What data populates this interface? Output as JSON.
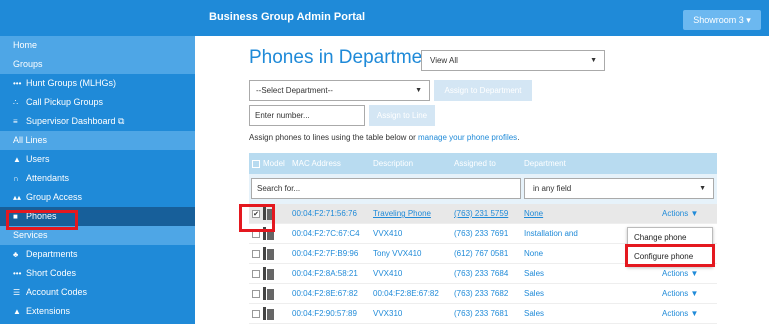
{
  "header": {
    "portal_title": "Business Group Admin Portal",
    "showroom": "Showroom 3 ▾"
  },
  "sidebar": {
    "items": [
      {
        "label": "Home",
        "section": true,
        "icon": ""
      },
      {
        "label": "Groups",
        "section": true,
        "icon": ""
      },
      {
        "label": "Hunt Groups (MLHGs)",
        "icon": "•••"
      },
      {
        "label": "Call Pickup Groups",
        "icon": "∴"
      },
      {
        "label": "Supervisor Dashboard ⧉",
        "icon": "≡"
      },
      {
        "label": "All Lines",
        "section": true,
        "icon": ""
      },
      {
        "label": "Users",
        "icon": "▲"
      },
      {
        "label": "Attendants",
        "icon": "∩"
      },
      {
        "label": "Group Access",
        "icon": "▴▴"
      },
      {
        "label": "Phones",
        "icon": "■",
        "active": true
      },
      {
        "label": "Services",
        "section": true,
        "icon": ""
      },
      {
        "label": "Departments",
        "icon": "♣"
      },
      {
        "label": "Short Codes",
        "icon": "•••"
      },
      {
        "label": "Account Codes",
        "icon": "☰"
      },
      {
        "label": "Extensions",
        "icon": "▲"
      }
    ]
  },
  "main": {
    "title": "Phones in Department:",
    "view_select": "View All",
    "dept_select": "--Select Department--",
    "assign_dept_btn": "Assign to Department",
    "number_placeholder": "Enter number...",
    "assign_line_btn": "Assign to Line",
    "help_prefix": "Assign phones to lines using the table below or ",
    "help_link": "manage your phone profiles",
    "help_suffix": "."
  },
  "table": {
    "headers": {
      "model": "Model",
      "mac": "MAC Address",
      "desc": "Description",
      "assigned": "Assigned to",
      "dept": "Department"
    },
    "search_placeholder": "Search for...",
    "field_select": "in any field",
    "rows": [
      {
        "mac": "00:04:F2:71:56:76",
        "desc": "Traveling Phone",
        "assigned": "(763) 231 5759",
        "dept": "None",
        "actions": "Actions ▼",
        "checked": true
      },
      {
        "mac": "00:04:F2:7C:67:C4",
        "desc": "VVX410",
        "assigned": "(763) 233 7691",
        "dept": "Installation and",
        "actions": ""
      },
      {
        "mac": "00:04:F2:7F:B9:96",
        "desc": "Tony VVX410",
        "assigned": "(612) 767 0581",
        "dept": "None",
        "actions": ""
      },
      {
        "mac": "00:04:F2:8A:58:21",
        "desc": "VVX410",
        "assigned": "(763) 233 7684",
        "dept": "Sales",
        "actions": "Actions ▼"
      },
      {
        "mac": "00:04:F2:8E:67:82",
        "desc": "00:04:F2:8E:67:82",
        "assigned": "(763) 233 7682",
        "dept": "Sales",
        "actions": "Actions ▼"
      },
      {
        "mac": "00:04:F2:90:57:89",
        "desc": "VVX310",
        "assigned": "(763) 233 7681",
        "dept": "Sales",
        "actions": "Actions ▼"
      }
    ]
  },
  "dropdown": {
    "items": [
      "Change phone",
      "Configure phone"
    ]
  },
  "colors": {
    "accent": "#1f8ad8",
    "highlight": "#e4181f"
  }
}
